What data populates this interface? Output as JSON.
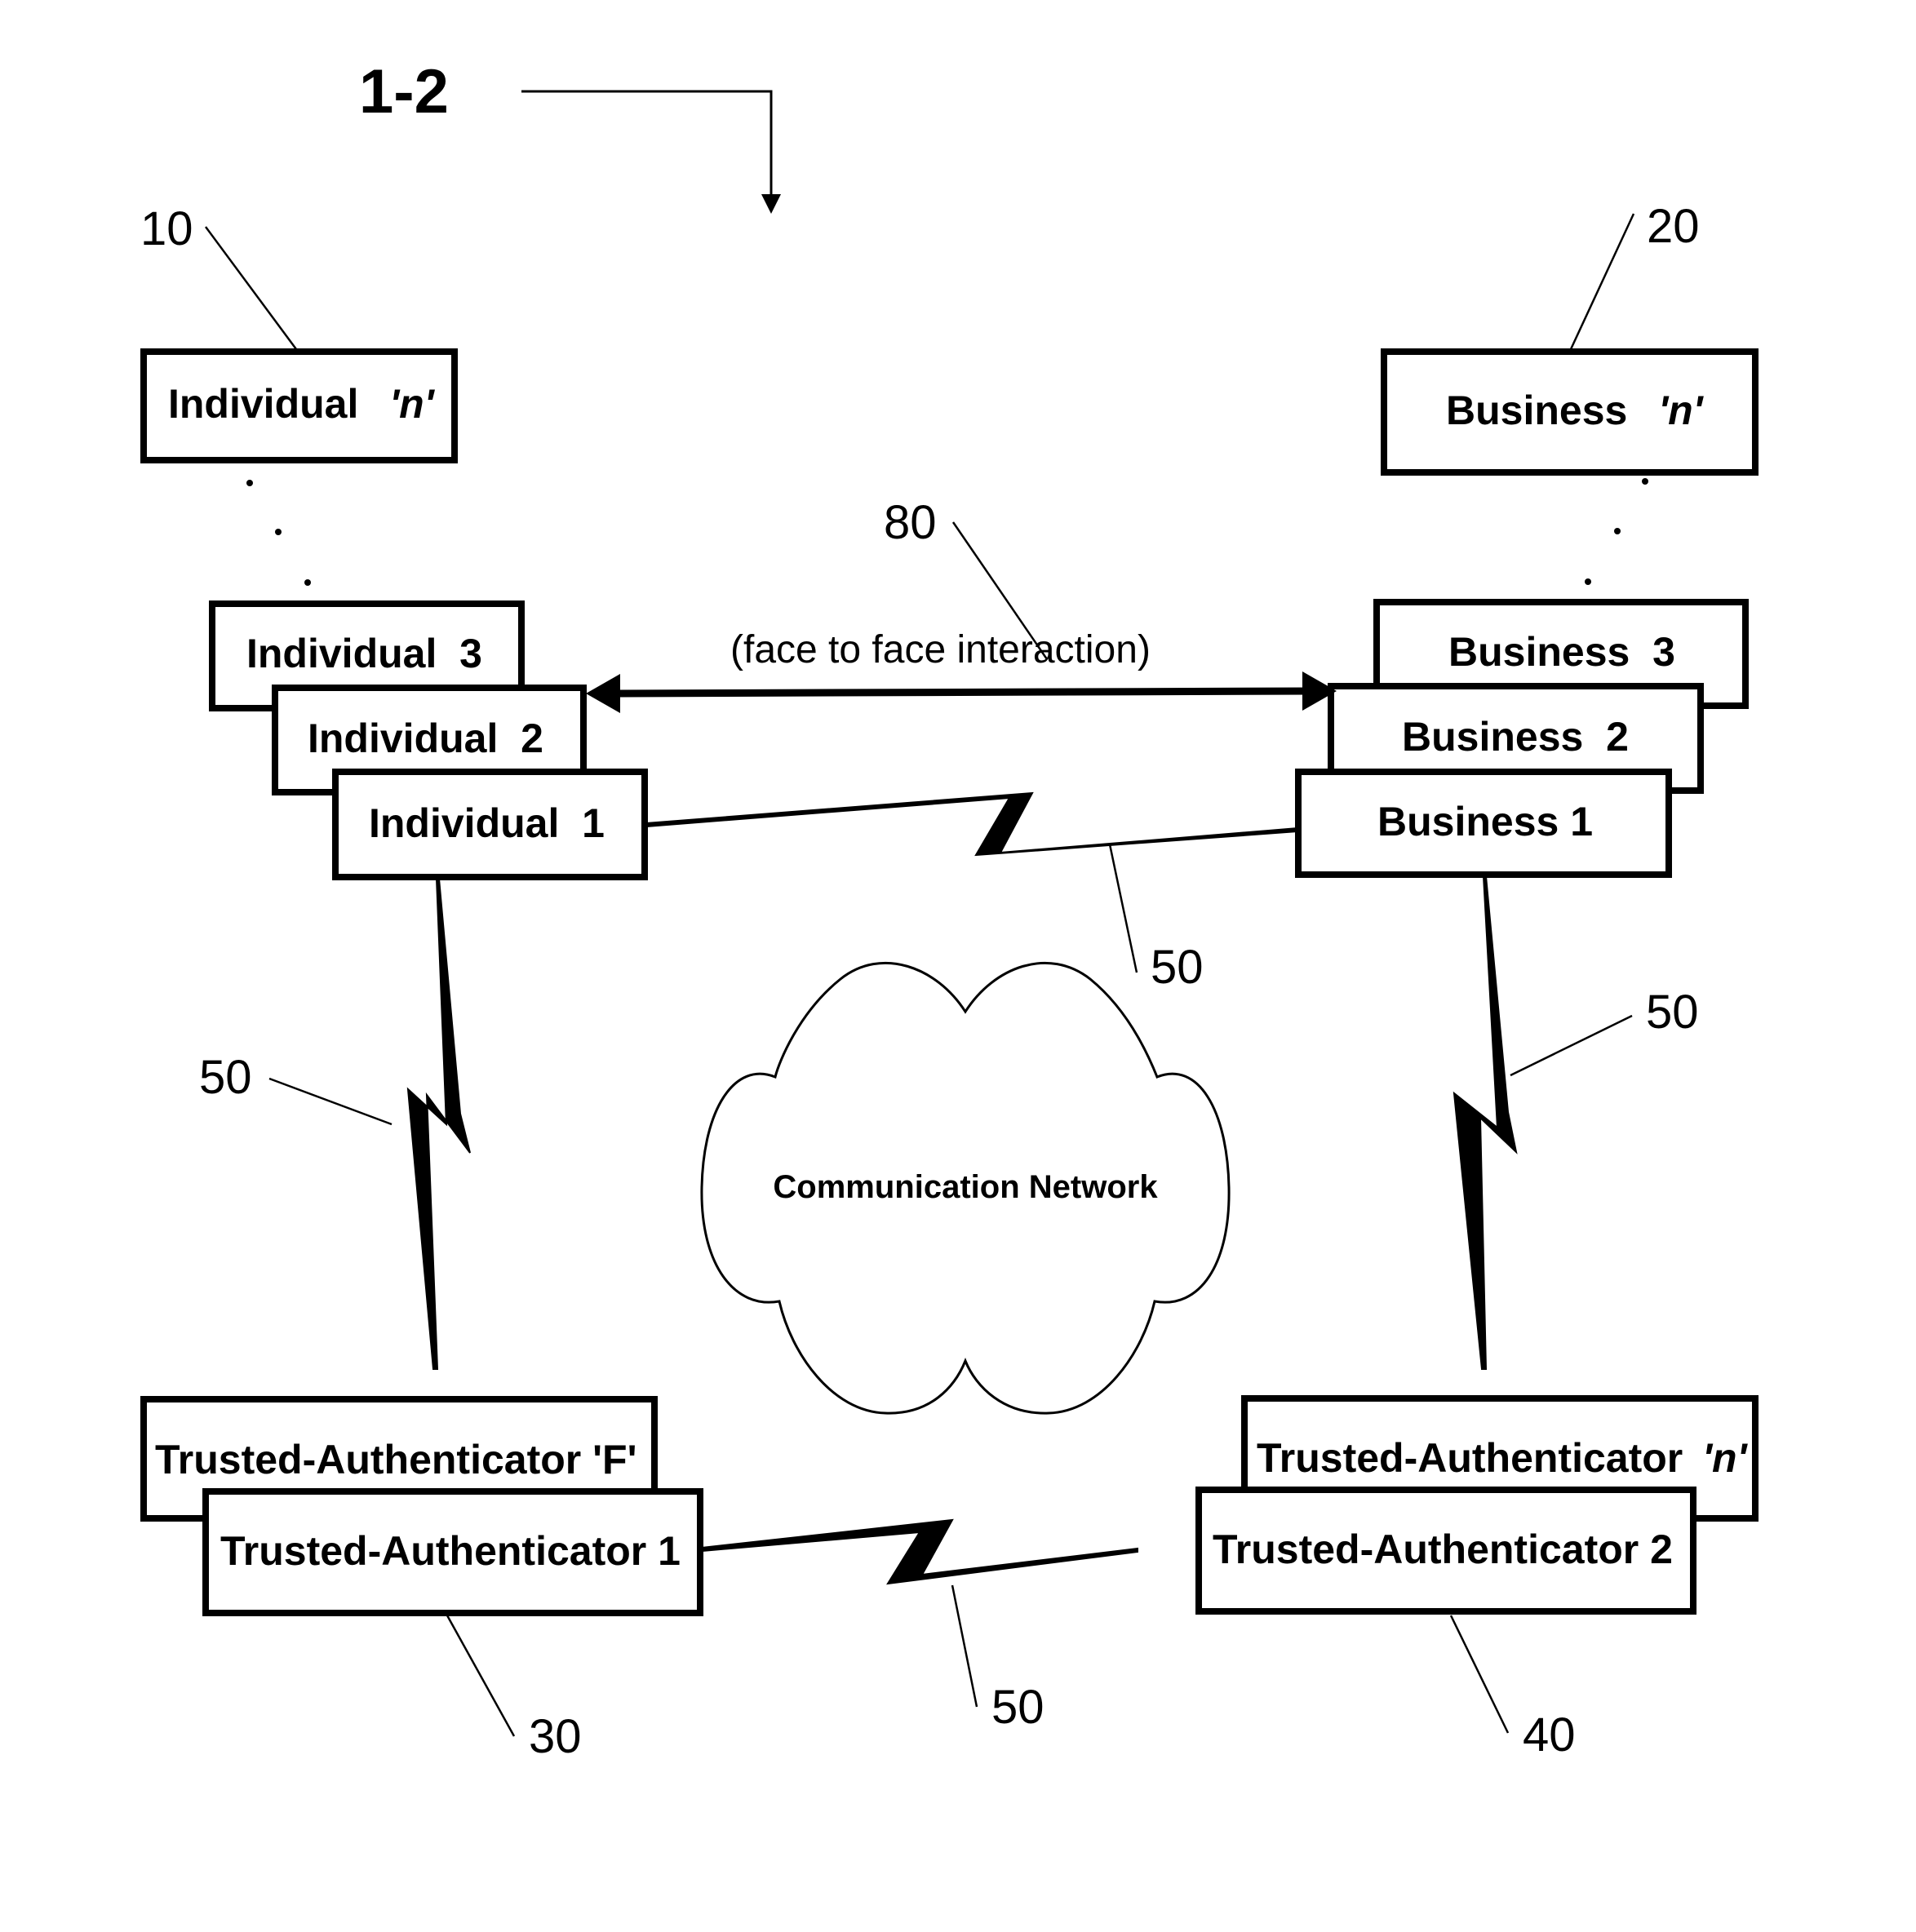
{
  "figure": {
    "label": "1-2"
  },
  "individuals": {
    "ref": "10",
    "boxes": [
      {
        "label": "Individual",
        "suffix": "'n'"
      },
      {
        "label": "Individual  3"
      },
      {
        "label": "Individual  2"
      },
      {
        "label": "Individual  1"
      }
    ]
  },
  "businesses": {
    "ref": "20",
    "boxes": [
      {
        "label": "Business",
        "suffix": "'n'"
      },
      {
        "label": "Business  3"
      },
      {
        "label": "Business  2"
      },
      {
        "label": "Business 1"
      }
    ]
  },
  "face_to_face": {
    "ref": "80",
    "caption": "(face to face interaction)"
  },
  "network": {
    "label": "Communication Network",
    "link_ref": "50"
  },
  "authenticators_left": {
    "ref": "30",
    "boxes": [
      {
        "label": "Trusted-Authenticator 'F'"
      },
      {
        "label": "Trusted-Authenticator 1"
      }
    ]
  },
  "authenticators_right": {
    "ref": "40",
    "boxes": [
      {
        "label": "Trusted-Authenticator",
        "suffix": "'n'"
      },
      {
        "label": "Trusted-Authenticator 2"
      }
    ]
  },
  "link_refs": {
    "top": "50",
    "left": "50",
    "right": "50",
    "bottom": "50"
  },
  "colors": {
    "stroke": "#000000",
    "background": "#ffffff"
  }
}
